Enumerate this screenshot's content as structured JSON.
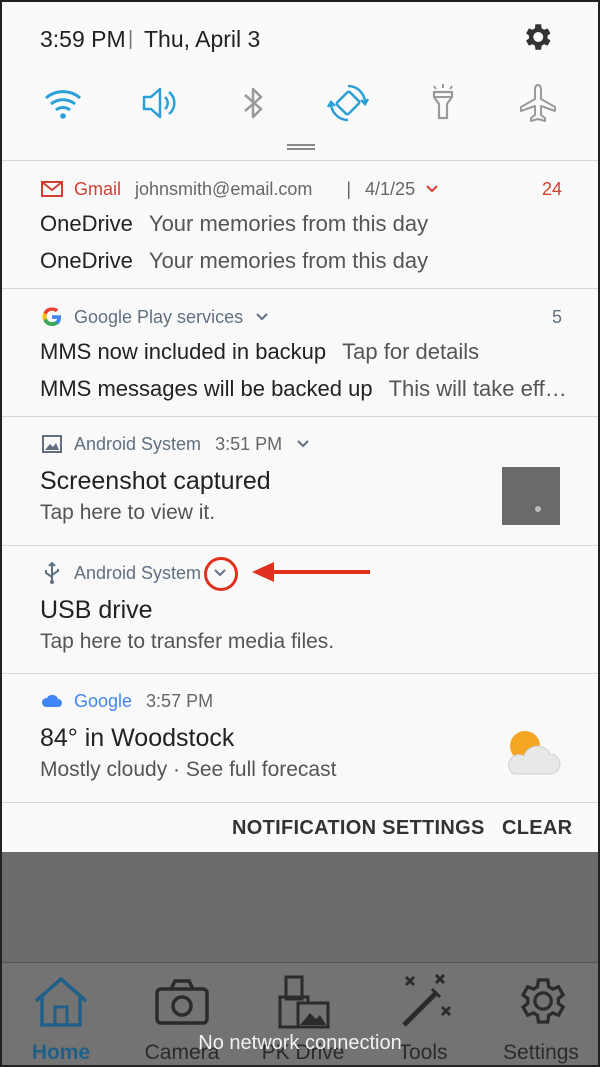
{
  "status": {
    "time": "3:59 PM",
    "separator": "|",
    "date": "Thu, April 3"
  },
  "quick_settings": [
    "wifi-icon",
    "volume-icon",
    "bluetooth-icon",
    "auto-rotate-icon",
    "flashlight-icon",
    "airplane-mode-icon"
  ],
  "notifications": {
    "gmail": {
      "app": "Gmail",
      "account": "johnsmith@email.com",
      "separator": "|",
      "date": "4/1/25",
      "count": "24",
      "lines": [
        {
          "title": "OneDrive",
          "text": "Your memories from this day"
        },
        {
          "title": "OneDrive",
          "text": "Your memories from this day"
        }
      ]
    },
    "play": {
      "app": "Google Play services",
      "count": "5",
      "lines": [
        {
          "title": "MMS now included in backup",
          "text": "Tap for details"
        },
        {
          "title": "MMS messages will be backed up",
          "text": "This will take eff…"
        }
      ]
    },
    "screenshot": {
      "app": "Android System",
      "time": "3:51 PM",
      "title": "Screenshot captured",
      "body": "Tap here to view it."
    },
    "usb": {
      "app": "Android System",
      "title": "USB drive",
      "body": "Tap here to transfer media files."
    },
    "weather": {
      "app": "Google",
      "time": "3:57 PM",
      "title": "84° in Woodstock",
      "body": "Mostly cloudy · See full forecast"
    }
  },
  "actions": {
    "settings": "NOTIFICATION SETTINGS",
    "clear": "CLEAR"
  },
  "app_behind": {
    "nav": [
      "Home",
      "Camera",
      "PK Drive",
      "Tools",
      "Settings"
    ],
    "toast": "No network connection"
  },
  "colors": {
    "accent": "#2a9fd8",
    "gmail_red": "#d23f31",
    "annotation": "#e0301e",
    "google_blue": "#4285f4"
  }
}
